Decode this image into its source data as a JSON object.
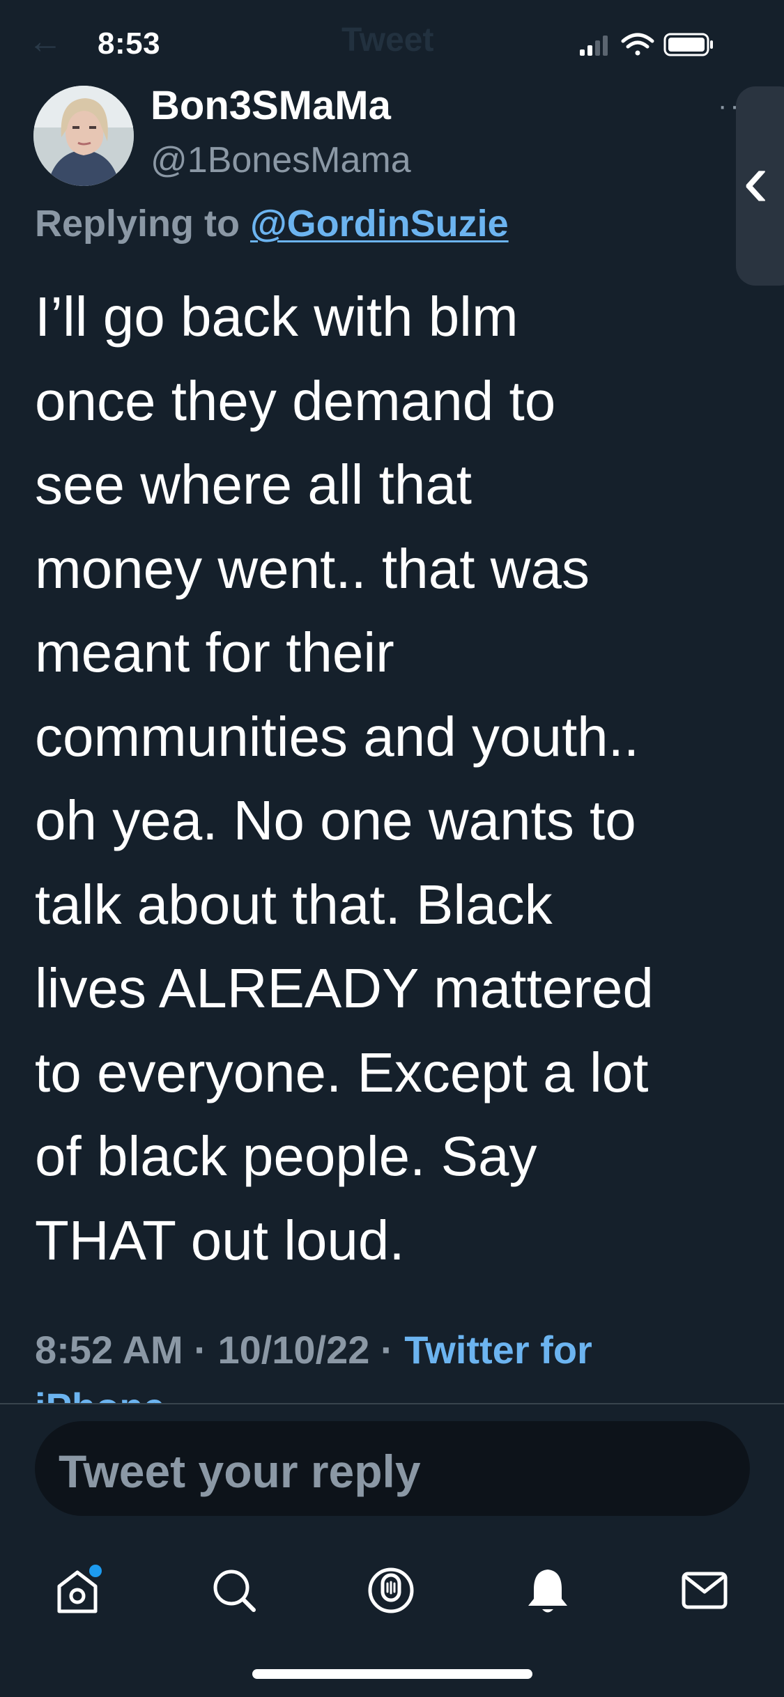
{
  "status_bar": {
    "time": "8:53",
    "signal_icon": "cellular-signal-icon",
    "wifi_icon": "wifi-icon",
    "battery_icon": "battery-icon"
  },
  "header": {
    "back_glyph": "←",
    "title": "Tweet"
  },
  "tweet": {
    "display_name": "Bon3SMaMa",
    "handle": "@1BonesMama",
    "replying_prefix": "Replying to ",
    "replying_to": "@GordinSuzie",
    "text": "I’ll go back with blm\nonce they demand to\nsee where all that\nmoney went.. that was\nmeant for their\ncommunities and youth..\noh yea. No one wants to\ntalk about that. Black\nlives ALREADY mattered\nto everyone. Except a lot\nof black people. Say\nTHAT out loud.",
    "time": "8:52 AM",
    "date": "10/10/22",
    "separator": "·",
    "source_line1": "Twitter for",
    "source_line2": "iPhone"
  },
  "reply": {
    "placeholder": "Tweet your reply"
  },
  "colors": {
    "background": "#15202b",
    "accent": "#6cb4f0",
    "muted": "#8b98a5",
    "notification_dot": "#1d9bf0"
  }
}
